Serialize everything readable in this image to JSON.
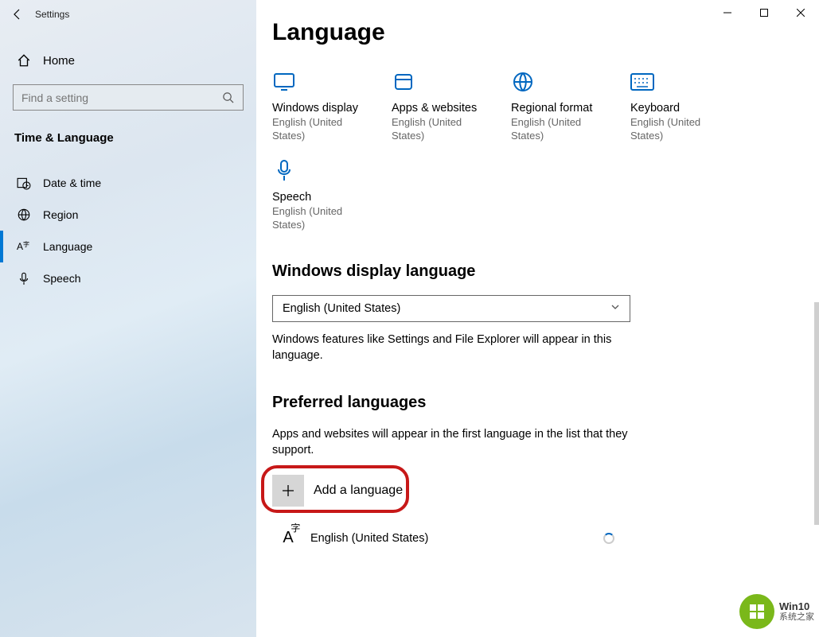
{
  "app": {
    "title": "Settings"
  },
  "nav": {
    "home": "Home",
    "search_placeholder": "Find a setting",
    "section": "Time & Language",
    "items": [
      {
        "label": "Date & time"
      },
      {
        "label": "Region"
      },
      {
        "label": "Language"
      },
      {
        "label": "Speech"
      }
    ]
  },
  "page": {
    "title": "Language",
    "tiles": [
      {
        "label": "Windows display",
        "value": "English (United States)"
      },
      {
        "label": "Apps & websites",
        "value": "English (United States)"
      },
      {
        "label": "Regional format",
        "value": "English (United States)"
      },
      {
        "label": "Keyboard",
        "value": "English (United States)"
      },
      {
        "label": "Speech",
        "value": "English (United States)"
      }
    ],
    "display_lang_section": "Windows display language",
    "display_lang_value": "English (United States)",
    "display_lang_help": "Windows features like Settings and File Explorer will appear in this language.",
    "preferred_section": "Preferred languages",
    "preferred_help": "Apps and websites will appear in the first language in the list that they support.",
    "add_language": "Add a language",
    "installed_lang": "English (United States)"
  },
  "watermark": {
    "line1": "Win10",
    "line2": "系统之家"
  }
}
